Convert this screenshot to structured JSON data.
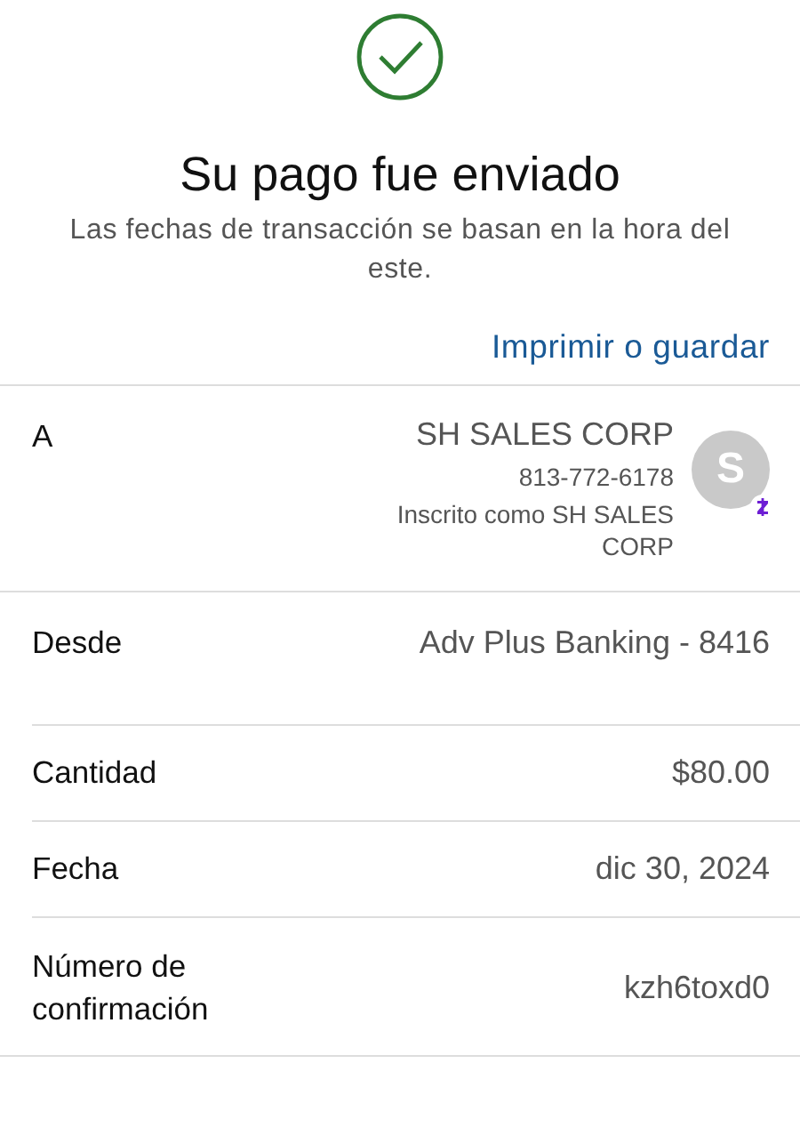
{
  "header": {
    "title": "Su pago fue enviado",
    "subtitle": "Las fechas de transacción se basan en la hora del este.",
    "link": "Imprimir o guardar"
  },
  "rows": [
    {
      "kind": "recipient",
      "label": "A",
      "name": "SH SALES CORP",
      "phone": "813-772-6178",
      "enrolled": "Inscrito como SH SALES CORP",
      "avatar": "S"
    },
    {
      "kind": "text",
      "label": "Desde",
      "value": "Adv Plus Banking - 8416"
    },
    {
      "kind": "text",
      "label": "Cantidad",
      "value": "$80.00"
    },
    {
      "kind": "text",
      "label": "Fecha",
      "value": "dic 30, 2024"
    },
    {
      "kind": "text",
      "label": "Número de confirmación",
      "value": "kzh6toxd0"
    }
  ]
}
